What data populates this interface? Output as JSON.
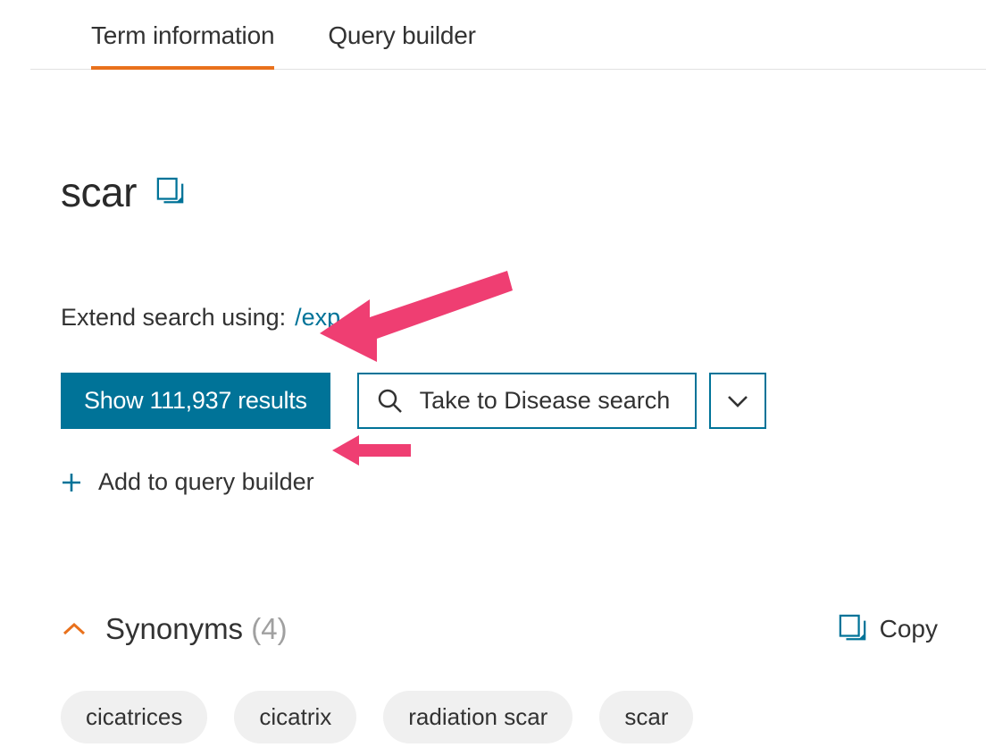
{
  "tabs": {
    "term_info": "Term information",
    "query_builder": "Query builder"
  },
  "term": "scar",
  "extend": {
    "label": "Extend search using:",
    "link": "/exp"
  },
  "actions": {
    "show_results": "Show 111,937 results",
    "take_to_disease": "Take to Disease search"
  },
  "add_to_qb": "Add to query builder",
  "synonyms": {
    "title": "Synonyms",
    "count": "(4)",
    "copy_label": "Copy",
    "items": [
      "cicatrices",
      "cicatrix",
      "radiation scar",
      "scar"
    ]
  }
}
